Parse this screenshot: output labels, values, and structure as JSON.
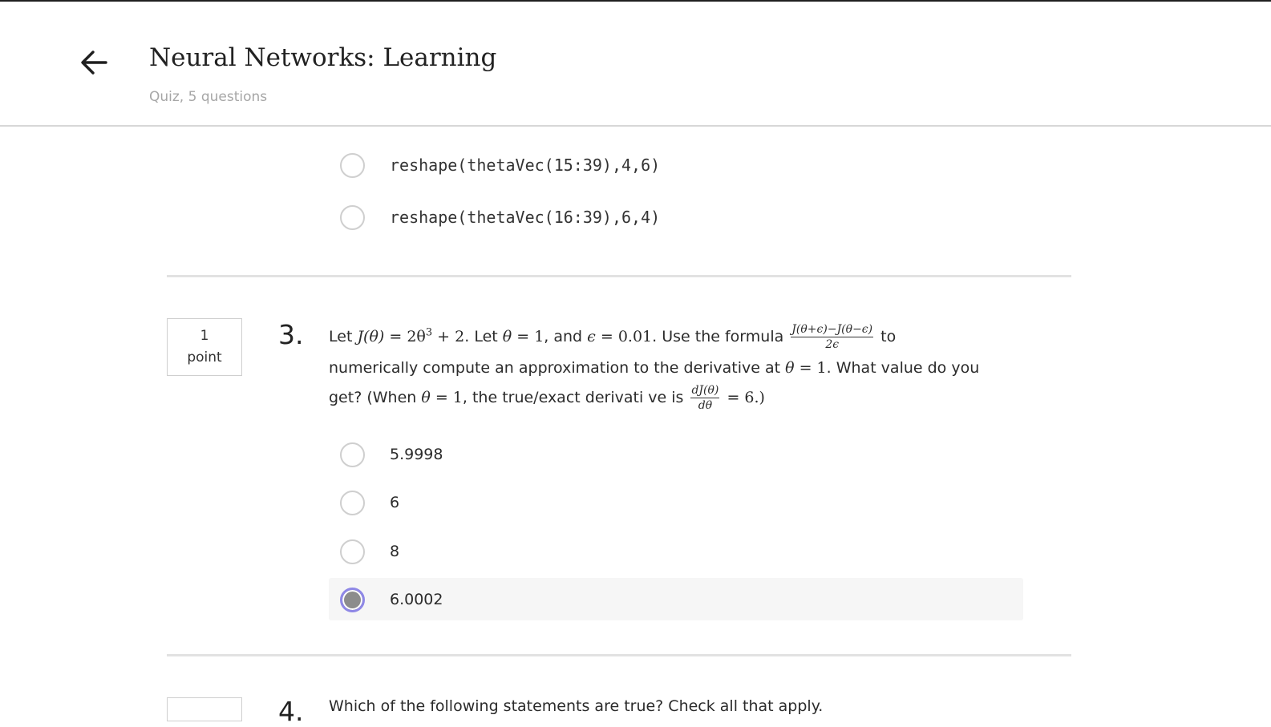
{
  "header": {
    "title": "Neural Networks: Learning",
    "subtitle": "Quiz, 5 questions"
  },
  "q2": {
    "options": [
      {
        "label": "reshape(thetaVec(15:39),4,6)",
        "selected": false
      },
      {
        "label": "reshape(thetaVec(16:39),6,4)",
        "selected": false
      }
    ]
  },
  "q3": {
    "points_value": "1",
    "points_unit": "point",
    "number": "3.",
    "text": {
      "let": "Let ",
      "J_theta": "J(θ)",
      "eq1": " = 2θ",
      "cube": "3",
      "plus2": " + 2",
      "let2": ". Let ",
      "theta": "θ",
      "eq_one": " = 1",
      "and": ", and ",
      "eps": "ϵ",
      "eq_eps": " = 0.01",
      "use": ". Use the formula",
      "frac_num": "J(θ+ϵ)−J(θ−ϵ)",
      "frac_den": "2ϵ",
      "to": "to",
      "line2_a": "numerically compute an approximation to the derivative at ",
      "line2_b": ". What value do you",
      "line3_a": "get? (When ",
      "line3_b": ", the true/exact derivati ve is",
      "deriv_num": "dJ(θ)",
      "deriv_den": "dθ",
      "line3_c": " = 6.)"
    },
    "options": [
      {
        "label": "5.9998",
        "selected": false
      },
      {
        "label": "6",
        "selected": false
      },
      {
        "label": "8",
        "selected": false
      },
      {
        "label": "6.0002",
        "selected": true
      }
    ]
  },
  "q4": {
    "number": "4.",
    "text": "Which of the following statements are true? Check all that apply."
  },
  "colors": {
    "accent_radio": "#8f88e6",
    "separator": "#e2e2e2",
    "selected_bg": "#f6f6f6"
  },
  "icons": {
    "back": "arrow-left-icon"
  }
}
